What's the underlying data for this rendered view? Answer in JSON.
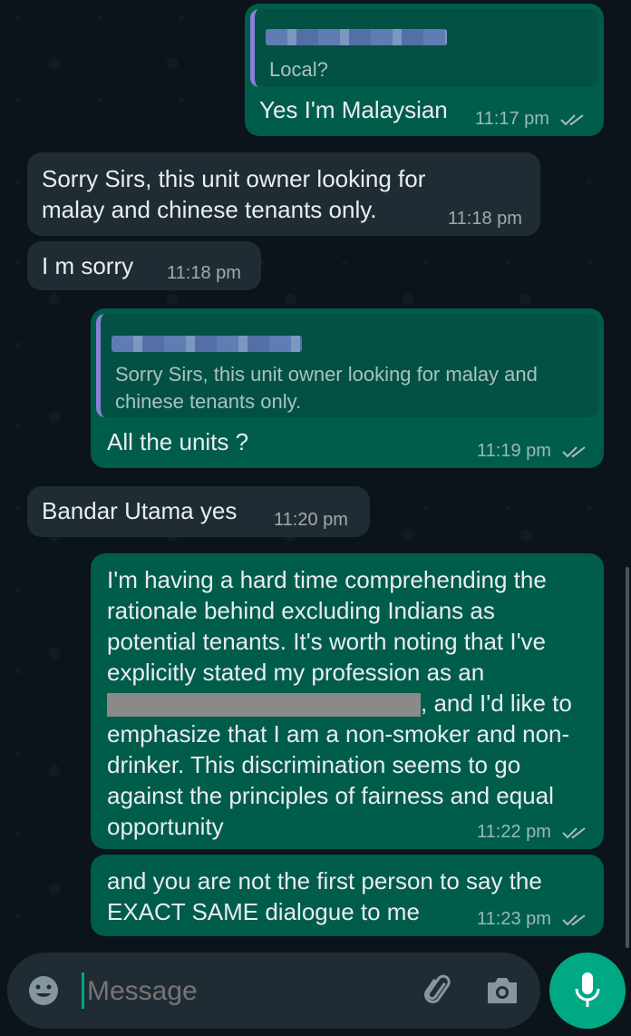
{
  "messages": [
    {
      "direction": "outgoing",
      "reply_to_text": "Local?",
      "text": "Yes I'm Malaysian",
      "time": "11:17 pm",
      "status": "read"
    },
    {
      "direction": "incoming",
      "text": "Sorry Sirs, this unit owner looking for malay and chinese tenants only.",
      "time": "11:18 pm"
    },
    {
      "direction": "incoming",
      "text": "I m sorry",
      "time": "11:18 pm"
    },
    {
      "direction": "outgoing",
      "reply_to_text": "Sorry Sirs, this unit owner looking for malay and chinese tenants only.",
      "text": "All the units ?",
      "time": "11:19 pm",
      "status": "read"
    },
    {
      "direction": "incoming",
      "text": "Bandar Utama yes",
      "time": "11:20 pm"
    },
    {
      "direction": "outgoing",
      "text_part1": "I'm having a hard time comprehending the rationale behind excluding Indians as potential tenants. It's worth noting that I've explicitly stated my profession as an",
      "text_part2": ", and I'd like to emphasize that I am a non-smoker and non-drinker. This discrimination seems to go against the principles of fairness and equal opportunity",
      "time": "11:22 pm",
      "status": "read"
    },
    {
      "direction": "outgoing",
      "text": "and you are not the first person to say the EXACT SAME dialogue to me",
      "time": "11:23 pm",
      "status": "read"
    }
  ],
  "composer": {
    "placeholder": "Message"
  },
  "icons": [
    "emoji-icon",
    "attach-icon",
    "camera-icon",
    "mic-icon",
    "read-ticks-icon"
  ],
  "colors": {
    "outgoing_bubble": "#005c4b",
    "incoming_bubble": "#202c33",
    "background": "#0b141a",
    "accent": "#00a884"
  }
}
